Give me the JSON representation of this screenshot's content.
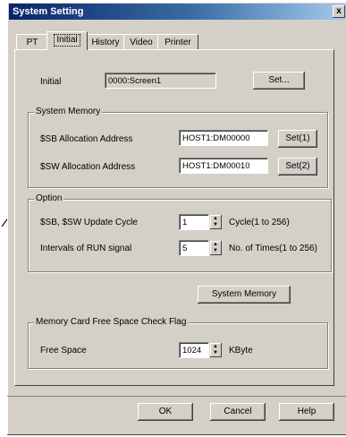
{
  "window": {
    "title": "System Setting",
    "close_glyph": "x"
  },
  "tabs": [
    {
      "label": "PT"
    },
    {
      "label": "Initial"
    },
    {
      "label": "History"
    },
    {
      "label": "Video"
    },
    {
      "label": "Printer"
    }
  ],
  "initial": {
    "label": "Initial",
    "value": "0000:Screen1",
    "set_label": "Set..."
  },
  "system_memory": {
    "title": "System Memory",
    "sb_label": "$SB Allocation Address",
    "sb_value": "HOST1:DM00000",
    "sb_button": "Set(1)",
    "sw_label": "$SW Allocation Address",
    "sw_value": "HOST1:DM00010",
    "sw_button": "Set(2)"
  },
  "option": {
    "title": "Option",
    "update_label": "$SB, $SW Update Cycle",
    "update_value": "1",
    "update_unit": "Cycle(1 to 256)",
    "run_label": "Intervals of RUN signal",
    "run_value": "5",
    "run_unit": "No. of Times(1 to 256)"
  },
  "system_memory_button": "System Memory",
  "memory_card": {
    "title": "Memory Card Free Space Check Flag",
    "free_label": "Free Space",
    "free_value": "1024",
    "free_unit": "KByte"
  },
  "footer": {
    "ok": "OK",
    "cancel": "Cancel",
    "help": "Help"
  }
}
